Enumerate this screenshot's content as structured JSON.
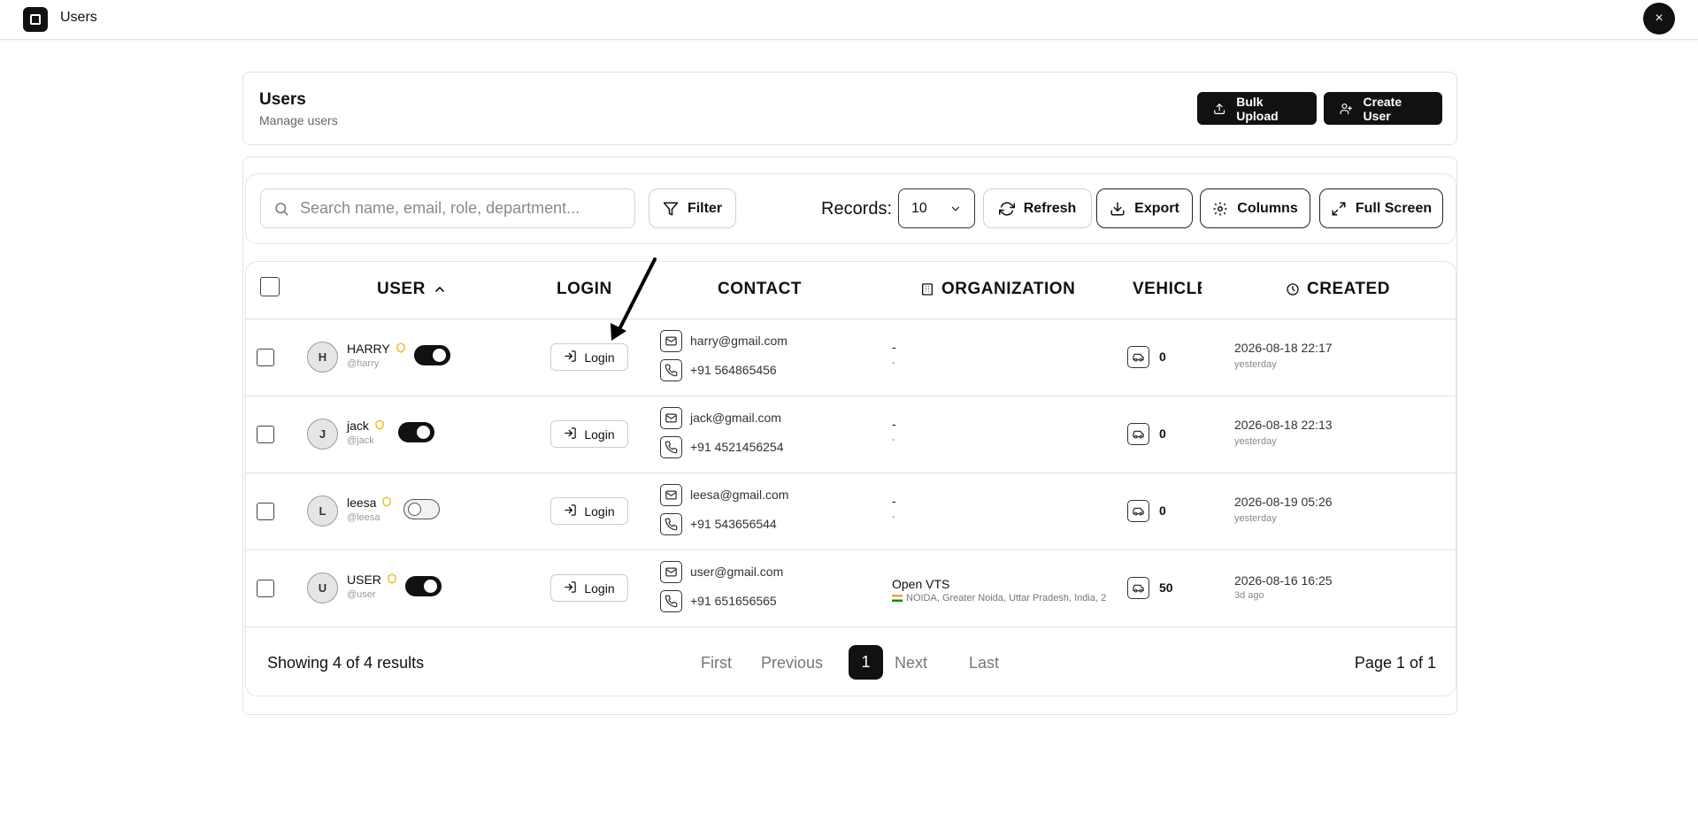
{
  "window": {
    "title": "Users",
    "close_icon": "×"
  },
  "header": {
    "title": "Users",
    "subtitle": "Manage users",
    "bulk_upload_label": "Bulk Upload",
    "create_user_label": "Create User"
  },
  "toolbar": {
    "search_placeholder": "Search name, email, role, department...",
    "search_value": "",
    "filter_label": "Filter",
    "records_label": "Records:",
    "records_value": "10",
    "refresh_label": "Refresh",
    "export_label": "Export",
    "columns_label": "Columns",
    "fullscreen_label": "Full Screen"
  },
  "table": {
    "columns": {
      "user": "USER",
      "login": "LOGIN",
      "contact": "CONTACT",
      "organization": "ORGANIZATION",
      "vehicle": "VEHICLE",
      "created": "CREATED"
    },
    "login_button_label": "Login",
    "rows": [
      {
        "initial": "H",
        "name": "HARRY",
        "handle": "@harry",
        "active": true,
        "email": "harry@gmail.com",
        "phone": "+91 564865456",
        "org": "-",
        "org_sub": "-",
        "vehicles": "0",
        "created": "2026-08-18 22:17",
        "created_rel": "yesterday"
      },
      {
        "initial": "J",
        "name": "jack",
        "handle": "@jack",
        "active": true,
        "email": "jack@gmail.com",
        "phone": "+91 4521456254",
        "org": "-",
        "org_sub": "-",
        "vehicles": "0",
        "created": "2026-08-18 22:13",
        "created_rel": "yesterday"
      },
      {
        "initial": "L",
        "name": "leesa",
        "handle": "@leesa",
        "active": false,
        "email": "leesa@gmail.com",
        "phone": "+91 543656544",
        "org": "-",
        "org_sub": "-",
        "vehicles": "0",
        "created": "2026-08-19 05:26",
        "created_rel": "yesterday"
      },
      {
        "initial": "U",
        "name": "USER",
        "handle": "@user",
        "active": true,
        "email": "user@gmail.com",
        "phone": "+91 651656565",
        "org": "Open VTS",
        "org_sub": "NOIDA, Greater Noida, Uttar Pradesh, India, 2",
        "vehicles": "50",
        "created": "2026-08-16 16:25",
        "created_rel": "3d ago"
      }
    ]
  },
  "pagination": {
    "showing": "Showing 4 of 4 results",
    "first": "First",
    "previous": "Previous",
    "current": "1",
    "next": "Next",
    "last": "Last",
    "page_of": "Page 1 of 1"
  },
  "colors": {
    "primary": "#111111",
    "border": "#e3e3e3",
    "muted_text": "#888888",
    "shield_badge": "#e6b800"
  }
}
